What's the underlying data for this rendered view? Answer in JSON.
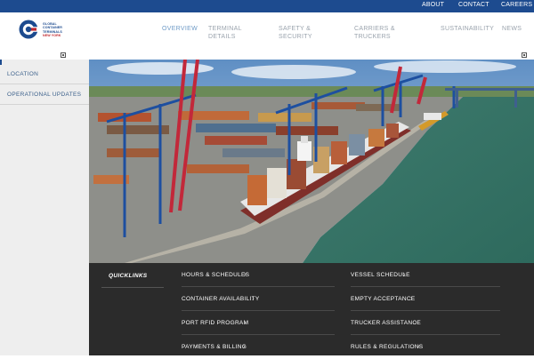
{
  "topbar": {
    "links": [
      "ABOUT",
      "CONTACT",
      "CAREERS"
    ]
  },
  "logo": {
    "line1": "GLOBAL",
    "line2": "CONTAINER",
    "line3": "TERMINALS",
    "line4": "NEW YORK"
  },
  "nav": {
    "overview": "OVERVIEW",
    "terminal": "TERMINAL\nDETAILS",
    "safety": "SAFETY &\nSECURITY",
    "carriers": "CARRIERS &\nTRUCKERS",
    "sustainability": "SUSTAINABILITY",
    "news": "NEWS"
  },
  "sidebar": {
    "items": [
      "LOCATION",
      "OPERATIONAL UPDATES"
    ]
  },
  "quicklinks": {
    "title": "QUICKLINKS",
    "col1": [
      "HOURS & SCHEDULES",
      "CONTAINER AVAILABILITY",
      "PORT RFID PROGRAM",
      "PAYMENTS & BILLING"
    ],
    "col2": [
      "VESSEL SCHEDULE",
      "EMPTY ACCEPTANCE",
      "TRUCKER ASSISTANCE",
      "RULES & REGULATIONS"
    ],
    "chevron": "›"
  },
  "colors": {
    "brand_blue": "#1d4b8f",
    "brand_red": "#c0272d",
    "panel_dark": "#2b2b2b",
    "sidebar_bg": "#eeeeee"
  }
}
